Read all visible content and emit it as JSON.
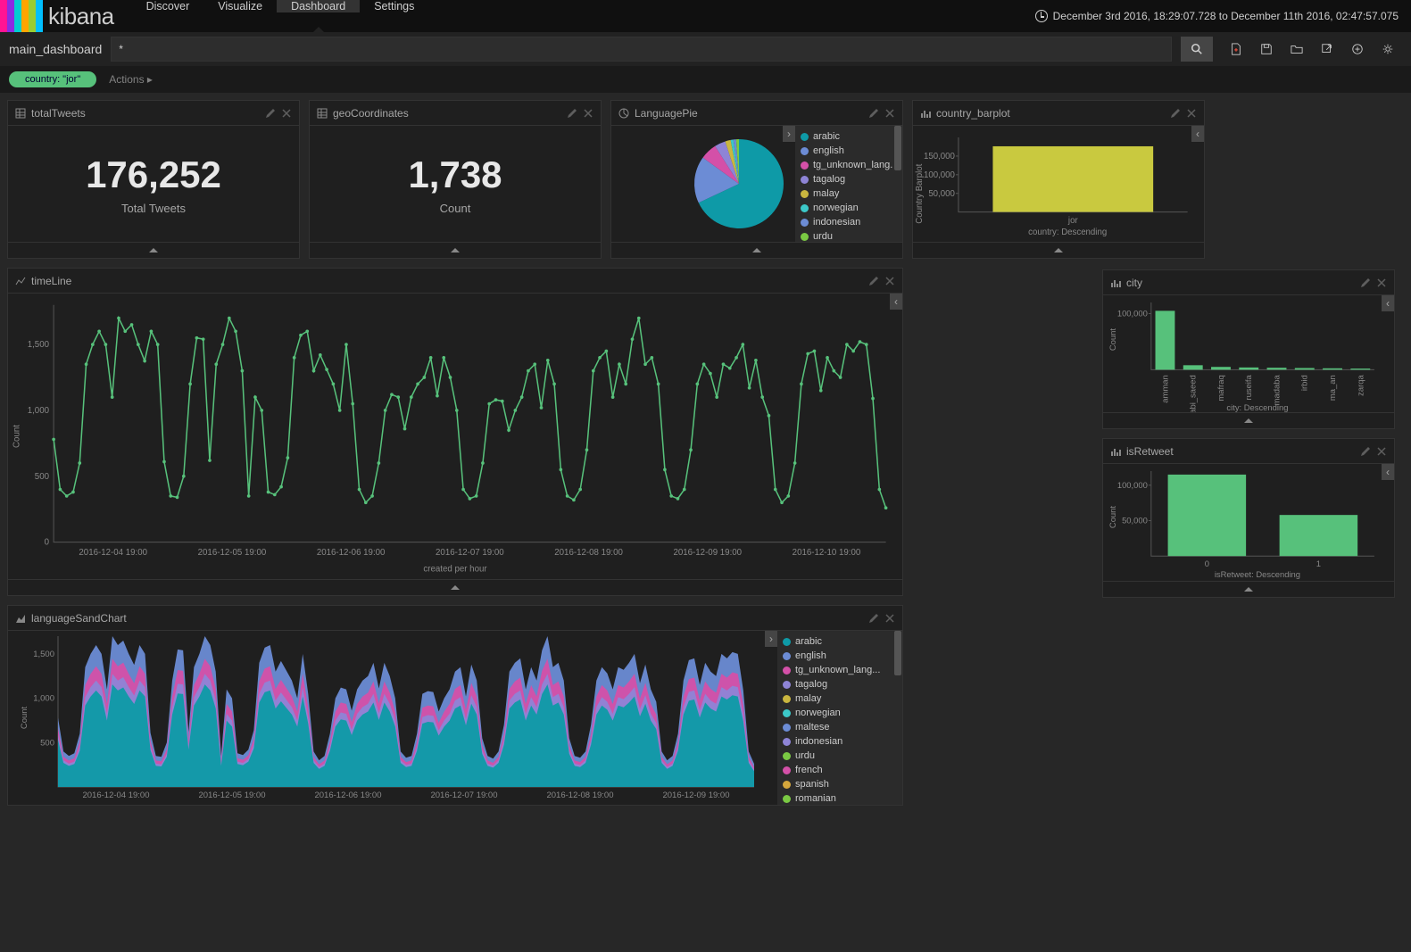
{
  "brand": "kibana",
  "logo_colors": [
    "#ff1493",
    "#8a2be2",
    "#00ced1",
    "#ffa500",
    "#9acd32",
    "#00bfff"
  ],
  "nav": {
    "items": [
      "Discover",
      "Visualize",
      "Dashboard",
      "Settings"
    ],
    "active": 2
  },
  "time_range": "December 3rd 2016, 18:29:07.728 to December 11th 2016, 02:47:57.075",
  "dashboard_name": "main_dashboard",
  "query": "*",
  "filter_pill": "country: \"jor\"",
  "actions_label": "Actions",
  "panels": {
    "totalTweets": {
      "title": "totalTweets",
      "value": "176,252",
      "label": "Total Tweets"
    },
    "geoCoordinates": {
      "title": "geoCoordinates",
      "value": "1,738",
      "label": "Count"
    },
    "languagePie": {
      "title": "LanguagePie"
    },
    "countryBar": {
      "title": "country_barplot",
      "ylabel": "Country Barplot",
      "xlabel": "country: Descending"
    },
    "timeLine": {
      "title": "timeLine",
      "ylabel": "Count",
      "xlabel": "created per hour"
    },
    "city": {
      "title": "city",
      "ylabel": "Count",
      "xlabel": "city: Descending"
    },
    "isRetweet": {
      "title": "isRetweet",
      "ylabel": "Count",
      "xlabel": "isRetweet: Descending"
    },
    "sand": {
      "title": "languageSandChart"
    }
  },
  "chart_data": {
    "pie": {
      "type": "pie",
      "title": "LanguagePie",
      "slices": [
        {
          "label": "arabic",
          "value": 68,
          "color": "#0e9aa7"
        },
        {
          "label": "english",
          "value": 17,
          "color": "#6c8cd5"
        },
        {
          "label": "tg_unknown_lang...",
          "value": 6,
          "color": "#d450a8"
        },
        {
          "label": "tagalog",
          "value": 4,
          "color": "#8e84d6"
        },
        {
          "label": "malay",
          "value": 2,
          "color": "#c9b63f"
        },
        {
          "label": "norwegian",
          "value": 1,
          "color": "#3cc8c8"
        },
        {
          "label": "indonesian",
          "value": 1,
          "color": "#6c8cd5"
        },
        {
          "label": "urdu",
          "value": 1,
          "color": "#7ac943"
        }
      ]
    },
    "country": {
      "type": "bar",
      "categories": [
        "jor"
      ],
      "values": [
        176252
      ],
      "ylim": [
        0,
        200000
      ],
      "yticks": [
        50000,
        100000,
        150000
      ],
      "color": "#c9c93f"
    },
    "timeline": {
      "type": "line",
      "ylabel": "Count",
      "xlabel": "created per hour",
      "ylim": [
        0,
        1800
      ],
      "yticks": [
        0,
        500,
        1000,
        1500
      ],
      "xticks": [
        "2016-12-04 19:00",
        "2016-12-05 19:00",
        "2016-12-06 19:00",
        "2016-12-07 19:00",
        "2016-12-08 19:00",
        "2016-12-09 19:00",
        "2016-12-10 19:00"
      ],
      "values": [
        780,
        400,
        350,
        380,
        600,
        1350,
        1500,
        1600,
        1500,
        1100,
        1700,
        1600,
        1650,
        1500,
        1375,
        1600,
        1500,
        610,
        350,
        340,
        500,
        1200,
        1550,
        1540,
        620,
        1350,
        1500,
        1700,
        1600,
        1300,
        350,
        1100,
        1000,
        380,
        360,
        420,
        640,
        1400,
        1570,
        1600,
        1300,
        1420,
        1310,
        1200,
        1000,
        1500,
        1050,
        400,
        300,
        350,
        600,
        1000,
        1120,
        1100,
        860,
        1100,
        1200,
        1250,
        1400,
        1110,
        1400,
        1250,
        1000,
        400,
        330,
        350,
        600,
        1050,
        1080,
        1070,
        850,
        1000,
        1100,
        1300,
        1350,
        1020,
        1380,
        1200,
        550,
        350,
        320,
        400,
        700,
        1300,
        1400,
        1450,
        1100,
        1350,
        1200,
        1540,
        1700,
        1350,
        1400,
        1200,
        550,
        350,
        330,
        400,
        700,
        1200,
        1350,
        1280,
        1100,
        1350,
        1320,
        1400,
        1500,
        1170,
        1380,
        1100,
        960,
        400,
        300,
        350,
        600,
        1200,
        1430,
        1450,
        1150,
        1400,
        1300,
        1250,
        1500,
        1450,
        1520,
        1500,
        1090,
        400,
        260
      ]
    },
    "city": {
      "type": "bar",
      "ylim": [
        0,
        120000
      ],
      "yticks": [
        100000
      ],
      "categories": [
        "amman",
        "der_abi_saeed",
        "mafraq",
        "ruseifa",
        "madaba",
        "irbid",
        "ma_an",
        "zarqa"
      ],
      "values": [
        105000,
        8000,
        5000,
        4000,
        3500,
        3000,
        2500,
        2000
      ],
      "color": "#57c17b"
    },
    "retweet": {
      "type": "bar",
      "ylim": [
        0,
        120000
      ],
      "yticks": [
        50000,
        100000
      ],
      "categories": [
        "0",
        "1"
      ],
      "values": [
        115000,
        58000
      ],
      "color": "#57c17b"
    },
    "sand": {
      "type": "area",
      "ylim": [
        0,
        1700
      ],
      "yticks": [
        500,
        1000,
        1500
      ],
      "xticks": [
        "2016-12-04 19:00",
        "2016-12-05 19:00",
        "2016-12-06 19:00",
        "2016-12-07 19:00",
        "2016-12-08 19:00",
        "2016-12-09 19:00"
      ],
      "legend": [
        {
          "label": "arabic",
          "color": "#0e9aa7"
        },
        {
          "label": "english",
          "color": "#6c8cd5"
        },
        {
          "label": "tg_unknown_lang...",
          "color": "#d450a8"
        },
        {
          "label": "tagalog",
          "color": "#8e84d6"
        },
        {
          "label": "malay",
          "color": "#c9b63f"
        },
        {
          "label": "norwegian",
          "color": "#3cc8c8"
        },
        {
          "label": "maltese",
          "color": "#6c8cd5"
        },
        {
          "label": "indonesian",
          "color": "#8e84d6"
        },
        {
          "label": "urdu",
          "color": "#7ac943"
        },
        {
          "label": "french",
          "color": "#d450a8"
        },
        {
          "label": "spanish",
          "color": "#d4a63c"
        },
        {
          "label": "romanian",
          "color": "#7ac943"
        }
      ]
    }
  }
}
